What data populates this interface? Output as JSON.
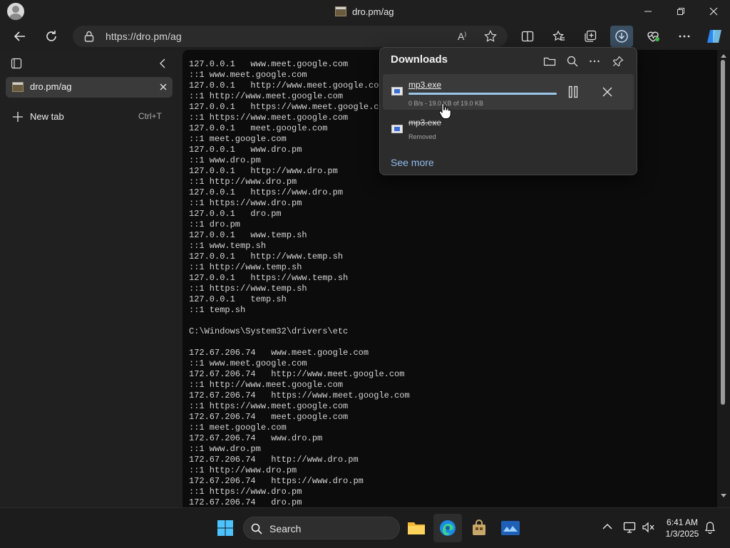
{
  "window": {
    "title": "dro.pm/ag",
    "minimize_icon": "minimize-icon",
    "restore_icon": "restore-icon",
    "close_icon": "close-icon"
  },
  "toolbar": {
    "url": "https://dro.pm/ag",
    "icons": [
      "back-icon",
      "refresh-icon",
      "lock-icon",
      "read-aloud-icon",
      "favorite-star-icon",
      "split-screen-icon",
      "favorites-icon",
      "collections-icon",
      "downloads-icon",
      "browser-essentials-icon",
      "more-icon",
      "copilot-icon"
    ]
  },
  "sidebar": {
    "active_tab": "dro.pm/ag",
    "new_tab_label": "New tab",
    "new_tab_shortcut": "Ctrl+T"
  },
  "terminal": {
    "lines": [
      "127.0.0.1   www.meet.google.com",
      "::1 www.meet.google.com",
      "127.0.0.1   http://www.meet.google.com",
      "::1 http://www.meet.google.com",
      "127.0.0.1   https://www.meet.google.com",
      "::1 https://www.meet.google.com",
      "127.0.0.1   meet.google.com",
      "::1 meet.google.com",
      "127.0.0.1   www.dro.pm",
      "::1 www.dro.pm",
      "127.0.0.1   http://www.dro.pm",
      "::1 http://www.dro.pm",
      "127.0.0.1   https://www.dro.pm",
      "::1 https://www.dro.pm",
      "127.0.0.1   dro.pm",
      "::1 dro.pm",
      "127.0.0.1   www.temp.sh",
      "::1 www.temp.sh",
      "127.0.0.1   http://www.temp.sh",
      "::1 http://www.temp.sh",
      "127.0.0.1   https://www.temp.sh",
      "::1 https://www.temp.sh",
      "127.0.0.1   temp.sh",
      "::1 temp.sh",
      "",
      "C:\\Windows\\System32\\drivers\\etc",
      "",
      "172.67.206.74   www.meet.google.com",
      "::1 www.meet.google.com",
      "172.67.206.74   http://www.meet.google.com",
      "::1 http://www.meet.google.com",
      "172.67.206.74   https://www.meet.google.com",
      "::1 https://www.meet.google.com",
      "172.67.206.74   meet.google.com",
      "::1 meet.google.com",
      "172.67.206.74   www.dro.pm",
      "::1 www.dro.pm",
      "172.67.206.74   http://www.dro.pm",
      "::1 http://www.dro.pm",
      "172.67.206.74   https://www.dro.pm",
      "::1 https://www.dro.pm",
      "172.67.206.74   dro.pm"
    ]
  },
  "downloads": {
    "title": "Downloads",
    "header_icons": [
      "open-folder-icon",
      "search-icon",
      "more-icon",
      "pin-icon"
    ],
    "items": [
      {
        "name": "mp3.exe",
        "status": "0 B/s - 19.0 KB of 19.0 KB",
        "progress": 1.0
      },
      {
        "name": "mp3.exe",
        "status": "Removed"
      }
    ],
    "see_more": "See more"
  },
  "taskbar": {
    "search_label": "Search",
    "apps": [
      "windows-start-icon",
      "file-explorer-icon",
      "edge-icon",
      "store-icon",
      "app-icon"
    ],
    "time": "6:41 AM",
    "date": "1/3/2025"
  },
  "colors": {
    "accent": "#9ac6ea",
    "link": "#8fbcf0",
    "terminal_bg": "#0c0c0c"
  }
}
